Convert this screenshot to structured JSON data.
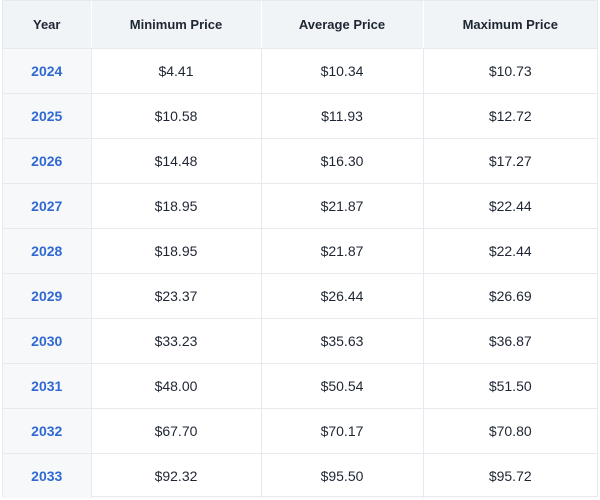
{
  "headers": [
    "Year",
    "Minimum Price",
    "Average Price",
    "Maximum Price"
  ],
  "rows": [
    {
      "year": "2024",
      "min": "$4.41",
      "avg": "$10.34",
      "max": "$10.73"
    },
    {
      "year": "2025",
      "min": "$10.58",
      "avg": "$11.93",
      "max": "$12.72"
    },
    {
      "year": "2026",
      "min": "$14.48",
      "avg": "$16.30",
      "max": "$17.27"
    },
    {
      "year": "2027",
      "min": "$18.95",
      "avg": "$21.87",
      "max": "$22.44"
    },
    {
      "year": "2028",
      "min": "$18.95",
      "avg": "$21.87",
      "max": "$22.44"
    },
    {
      "year": "2029",
      "min": "$23.37",
      "avg": "$26.44",
      "max": "$26.69"
    },
    {
      "year": "2030",
      "min": "$33.23",
      "avg": "$35.63",
      "max": "$36.87"
    },
    {
      "year": "2031",
      "min": "$48.00",
      "avg": "$50.54",
      "max": "$51.50"
    },
    {
      "year": "2032",
      "min": "$67.70",
      "avg": "$70.17",
      "max": "$70.80"
    },
    {
      "year": "2033",
      "min": "$92.32",
      "avg": "$95.50",
      "max": "$95.72"
    }
  ],
  "colors": {
    "header_bg": "#f1f4f7",
    "year_bg": "#f7f8fa",
    "year_text": "#3169d3",
    "text": "#1f2633",
    "border": "#e6e9ee"
  }
}
